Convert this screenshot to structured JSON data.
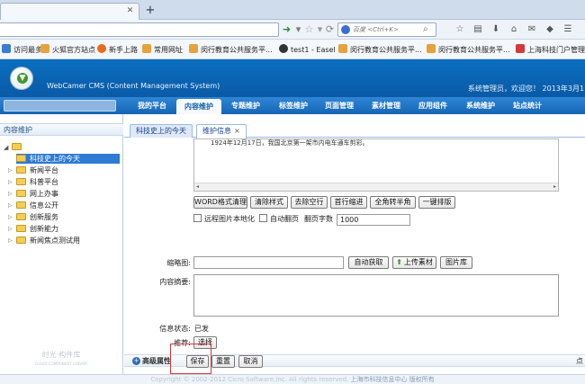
{
  "browser": {
    "tab_title": "",
    "new_tab_label": "+",
    "search_placeholder": "百度 <Ctrl+K>"
  },
  "bookmarks": [
    {
      "label": "访问最多",
      "color": "#3a7bd5"
    },
    {
      "label": "火狐官方站点",
      "color": "#e6a23c"
    },
    {
      "label": "新手上路",
      "color": "#e86a1c"
    },
    {
      "label": "常用网址",
      "color": "#e6a23c"
    },
    {
      "label": "闵行教育公共服务平...",
      "color": "#e6a23c"
    },
    {
      "label": "test1 - Easel",
      "color": "#333333"
    },
    {
      "label": "闵行教育公共服务平...",
      "color": "#e6a23c"
    },
    {
      "label": "闵行教育公共服务平...",
      "color": "#e6a23c"
    },
    {
      "label": "上海科技门户管理",
      "color": "#d23a3a"
    }
  ],
  "cms": {
    "title": "WebCamer CMS (Content Management System)",
    "welcome": "系统管理员，欢迎您！  2013年3月1"
  },
  "menu": [
    {
      "label": "我的平台",
      "active": false
    },
    {
      "label": "内容维护",
      "active": true
    },
    {
      "label": "专题维护",
      "active": false
    },
    {
      "label": "标签维护",
      "active": false
    },
    {
      "label": "页面管理",
      "active": false
    },
    {
      "label": "素材管理",
      "active": false
    },
    {
      "label": "应用组件",
      "active": false
    },
    {
      "label": "系统维护",
      "active": false
    },
    {
      "label": "站点统计",
      "active": false
    }
  ],
  "sidebar": {
    "heading": "内容维护",
    "items": [
      {
        "label": "科技史上的今天",
        "selected": true
      },
      {
        "label": "新闻平台",
        "selected": false
      },
      {
        "label": "科普平台",
        "selected": false
      },
      {
        "label": "网上办事",
        "selected": false
      },
      {
        "label": "信息公开",
        "selected": false
      },
      {
        "label": "创新服务",
        "selected": false
      },
      {
        "label": "创新能力",
        "selected": false
      },
      {
        "label": "新闻焦点测试用",
        "selected": false
      }
    ],
    "logo_text": "时光·构件库",
    "logo_sub": "CLOUD COMPONENT LIBRARY"
  },
  "tabs": [
    {
      "label": "科技史上的今天"
    },
    {
      "label": "维护信息"
    }
  ],
  "editor": {
    "content_text": "1924年12月17日，我国北京第一架市内电车通车剪彩。",
    "toolbar": [
      "WORD格式清理",
      "清除样式",
      "去除空行",
      "首行缩进",
      "全角转半角",
      "一键排版"
    ]
  },
  "options": {
    "remote_image": "远程图片本地化",
    "auto_page": "自动翻页",
    "page_chars_label": "翻页字数",
    "page_chars_value": "1000"
  },
  "form": {
    "thumbnail_label": "缩略图:",
    "auto_get": "自动获取",
    "upload": "上传素材",
    "gallery": "图片库",
    "summary_label": "内容摘要:",
    "status_label": "信息状态:",
    "status_value": "已发",
    "recommend_label": "推荐:",
    "select_button": "选择",
    "advanced": "高级属性",
    "advanced_right": "点"
  },
  "actions": {
    "save": "保存",
    "reset": "重置",
    "cancel": "取消"
  },
  "footer": {
    "copyright": "Copyright © 2002-2012 Cicro Software,Inc. All rights reserved.",
    "owner": "上海市科技信息中心 版权所有"
  }
}
